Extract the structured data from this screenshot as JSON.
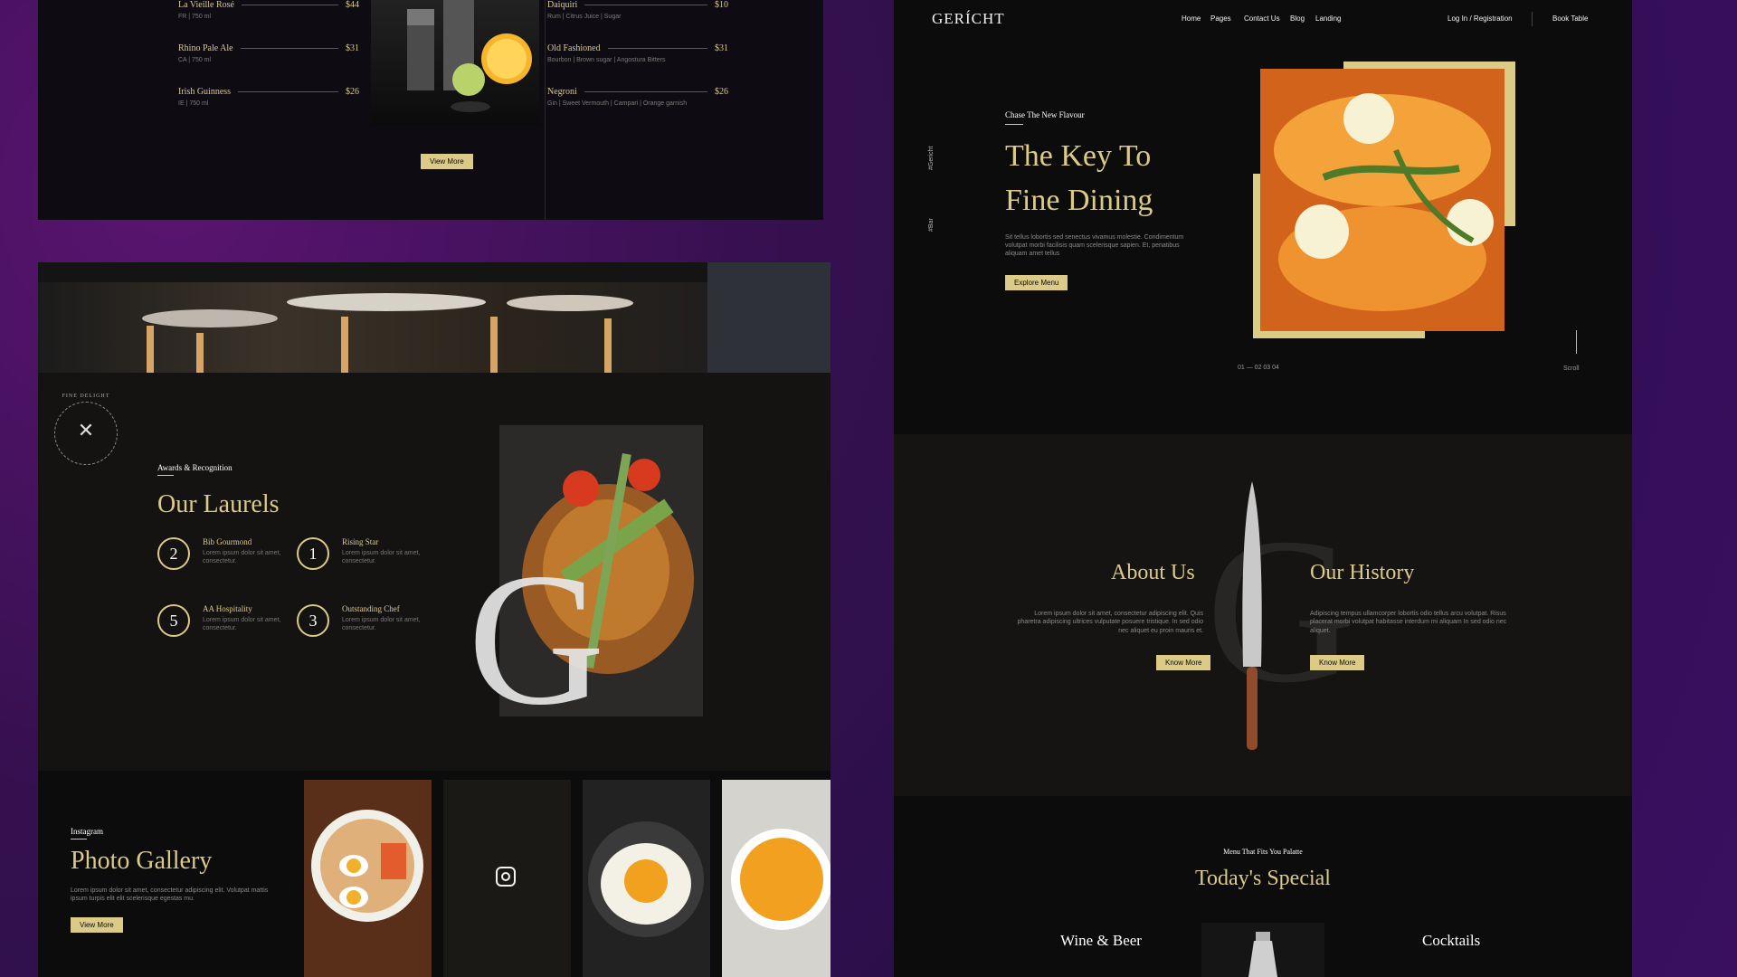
{
  "colors": {
    "gold": "#DCCA87",
    "black": "#0C0C0C",
    "bg_purple": "#35104F"
  },
  "drinks_menu": {
    "left_items": [
      {
        "name": "La Vieille Rosé",
        "price": "$44",
        "desc": "FR | 750 ml"
      },
      {
        "name": "Rhino Pale Ale",
        "price": "$31",
        "desc": "CA | 750 ml"
      },
      {
        "name": "Irish Guinness",
        "price": "$26",
        "desc": "IE | 750 ml"
      }
    ],
    "right_items": [
      {
        "name": "Daiquiri",
        "price": "$10",
        "desc": "Rum | Citrus Juice | Sugar"
      },
      {
        "name": "Old Fashioned",
        "price": "$31",
        "desc": "Bourbon | Brown sugar | Angostura Bitters"
      },
      {
        "name": "Negroni",
        "price": "$26",
        "desc": "Gin | Sweet Vermouth | Campari | Orange garnish"
      }
    ],
    "button": "View More",
    "image_icon": "cocktail-shaker-image"
  },
  "laurels": {
    "stamp_text": "FINE DELIGHT",
    "subtitle": "Awards & Recognition",
    "title": "Our Laurels",
    "awards": [
      {
        "number": "2",
        "title": "Bib Gourmond",
        "text": "Lorem ipsum dolor sit amet, consectetur."
      },
      {
        "number": "1",
        "title": "Rising Star",
        "text": "Lorem ipsum dolor sit amet, consectetur."
      },
      {
        "number": "5",
        "title": "AA Hospitality",
        "text": "Lorem ipsum dolor sit amet, consectetur."
      },
      {
        "number": "3",
        "title": "Outstanding Chef",
        "text": "Lorem ipsum dolor sit amet, consectetur."
      }
    ],
    "big_letter": "G"
  },
  "gallery": {
    "subtitle": "Instagram",
    "title": "Photo Gallery",
    "text": "Lorem ipsum dolor sit amet, consectetur adipiscing elit. Volutpat mattis ipsum turpis elit elit scelerisque egestas mu.",
    "button": "View More",
    "instagram_icon": "instagram-icon"
  },
  "gericht": {
    "logo": "GERÍCHT",
    "nav": [
      "Home",
      "Pages",
      "Contact Us",
      "Blog",
      "Landing"
    ],
    "auth": "Log In / Registration",
    "book": "Book Table",
    "hero_subtitle": "Chase The New Flavour",
    "hero_title_1": "The Key To",
    "hero_title_2": "Fine Dining",
    "hero_text": "Sit tellus lobortis sed senectus vivamus molestie. Condimentum volutpat morbi facilisis quam scelerisque sapien. Et, penatibus aliquam amet tellus",
    "hero_button": "Explore Menu",
    "side_social": [
      "#Gericht",
      "#Bar"
    ],
    "slider_dots": "01 — 02 03 04",
    "scroll_label": "Scroll",
    "about_title": "About Us",
    "about_text": "Lorem ipsum dolor sit amet, consectetur adipiscing elit. Quis pharetra adipiscing ultrices vulputate posuere tristique. In sed odio nec aliquet eu proin mauris et.",
    "about_button": "Know More",
    "history_title": "Our History",
    "history_text": "Adipiscing tempus ullamcorper lobortis odio tellus arcu volutpat. Risus placerat morbi volutpat habitasse interdum mi aliquam In sed odio nec aliquet.",
    "history_button": "Know More",
    "special_subtitle": "Menu That Fits You Palatte",
    "special_title": "Today's Special",
    "wine_title": "Wine & Beer",
    "cocktails_title": "Cocktails"
  }
}
